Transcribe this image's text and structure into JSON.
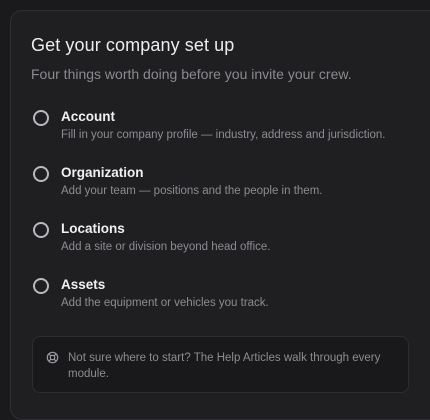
{
  "card": {
    "title": "Get your company set up",
    "subtitle": "Four things worth doing before you invite your crew."
  },
  "steps": [
    {
      "title": "Account",
      "description": "Fill in your company profile — industry, address and jurisdiction.",
      "completed": false
    },
    {
      "title": "Organization",
      "description": "Add your team — positions and the people in them.",
      "completed": false
    },
    {
      "title": "Locations",
      "description": "Add a site or division beyond head office.",
      "completed": false
    },
    {
      "title": "Assets",
      "description": "Add the equipment or vehicles you track.",
      "completed": false
    }
  ],
  "help": {
    "icon": "lifebuoy-icon",
    "text": "Not sure where to start? The Help Articles walk through every module."
  },
  "colors": {
    "background": "#1a1a1c",
    "card": "#1f1f22",
    "text_primary": "#ececee",
    "text_secondary": "#8a8a90"
  }
}
